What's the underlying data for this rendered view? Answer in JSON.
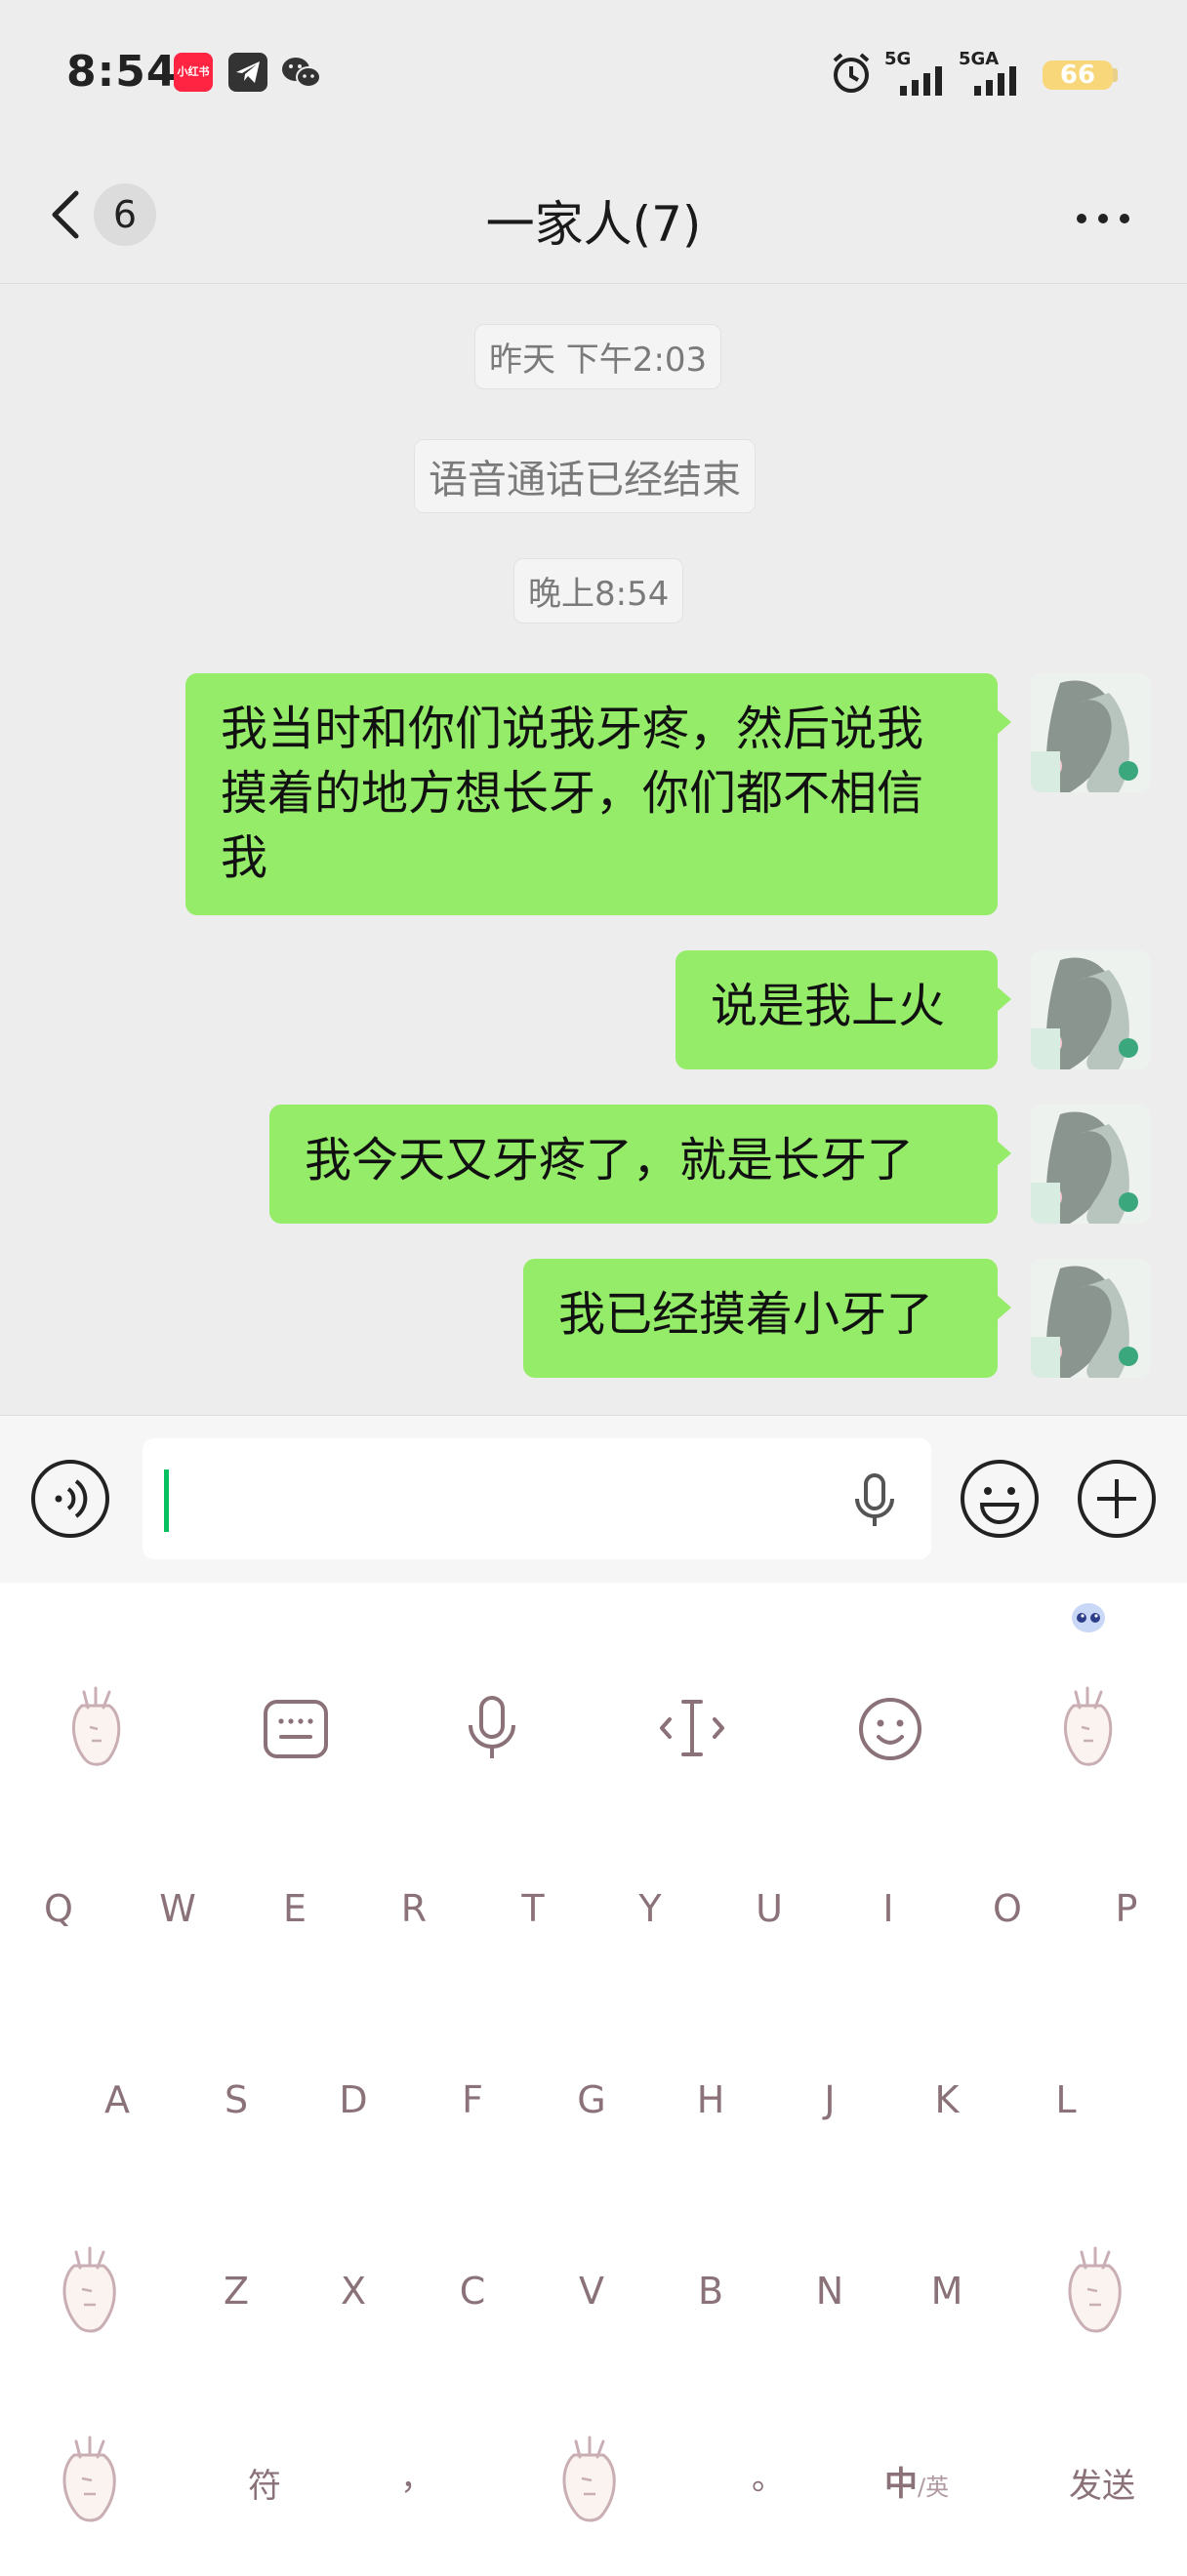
{
  "status_bar": {
    "time": "8:54",
    "network1": "5G",
    "network2": "5GA",
    "battery": "66",
    "app_icons": [
      "xiaohongshu-icon",
      "telegram-icon",
      "wechat-icon"
    ],
    "xiaohongshu_label": "小红书"
  },
  "nav": {
    "unread_count": "6",
    "title": "一家人(7)"
  },
  "messages": {
    "ts_yesterday": "昨天 下午2:03",
    "call_ended": "语音通话已经结束",
    "ts_evening": "晚上8:54",
    "m1_line1": "我当时和你们说我牙疼，然后说我",
    "m1_line2": "摸着的地方想长牙，你们都不相信",
    "m1_line3": "我",
    "m2": "说是我上火",
    "m3": "我今天又牙疼了，就是长牙了",
    "m4": "我已经摸着小牙了"
  },
  "input": {
    "value": "",
    "placeholder": ""
  },
  "keyboard": {
    "row1": [
      "Q",
      "W",
      "E",
      "R",
      "T",
      "Y",
      "U",
      "I",
      "O",
      "P"
    ],
    "row2": [
      "A",
      "S",
      "D",
      "F",
      "G",
      "H",
      "J",
      "K",
      "L"
    ],
    "row3": [
      "Z",
      "X",
      "C",
      "V",
      "B",
      "N",
      "M"
    ],
    "symbols": "符",
    "comma": "，",
    "period": "。",
    "lang_zh": "中",
    "lang_sep": "/英",
    "send": "发送"
  },
  "colors": {
    "bubble": "#95ec69",
    "accent": "#07c160",
    "key_text": "#8a7278"
  }
}
